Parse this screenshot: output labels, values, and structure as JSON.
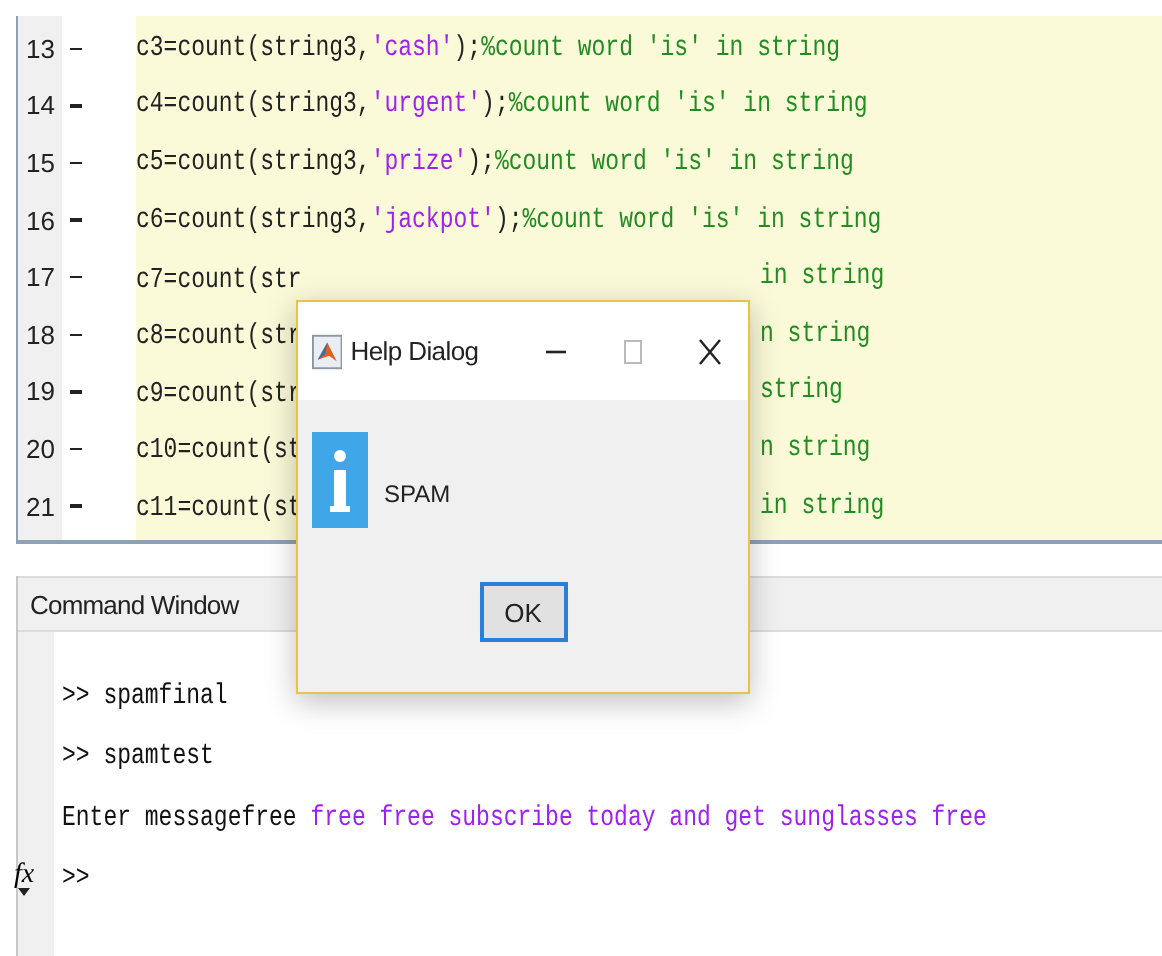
{
  "editor": {
    "lines": [
      {
        "number": "13",
        "kind": "full",
        "code": "c3=count(string3,",
        "string": "'cash'",
        "rest": ");",
        "comment": "%count word 'is' in string"
      },
      {
        "number": "14",
        "kind": "full",
        "code": "c4=count(string3,",
        "string": "'urgent'",
        "rest": ");",
        "comment": "%count word 'is' in string"
      },
      {
        "number": "15",
        "kind": "full",
        "code": "c5=count(string3,",
        "string": "'prize'",
        "rest": ");",
        "comment": "%count word 'is' in string"
      },
      {
        "number": "16",
        "kind": "full",
        "code": "c6=count(string3,",
        "string": "'jackpot'",
        "rest": ");",
        "comment": "%count word 'is' in string"
      },
      {
        "number": "17",
        "kind": "covered",
        "code": "c7=count(str",
        "comment": "in string"
      },
      {
        "number": "18",
        "kind": "covered",
        "code": "c8=count(str",
        "comment": "n string"
      },
      {
        "number": "19",
        "kind": "covered",
        "code": "c9=count(str",
        "comment": "string"
      },
      {
        "number": "20",
        "kind": "covered",
        "code": "c10=count(st",
        "comment": "n string"
      },
      {
        "number": "21",
        "kind": "covered",
        "code": "c11=count(st",
        "comment": "in string"
      }
    ]
  },
  "command_window": {
    "title": "Command Window",
    "lines": [
      {
        "kind": "command",
        "prompt": ">>",
        "text": "spamfinal"
      },
      {
        "kind": "command",
        "prompt": ">>",
        "text": "spamtest"
      },
      {
        "kind": "output",
        "text": "Enter messagefree",
        "input": "free free subscribe today and get sunglasses free"
      },
      {
        "kind": "prompt",
        "prompt": ">>",
        "function_button": "fx"
      }
    ]
  },
  "dialog": {
    "title": "Help Dialog",
    "message": "SPAM",
    "button": "OK"
  }
}
